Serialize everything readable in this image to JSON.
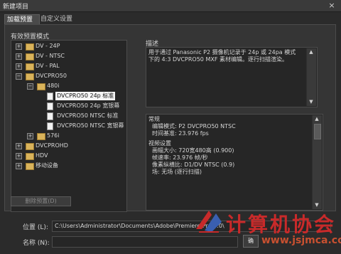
{
  "window": {
    "title": "新建项目",
    "close_glyph": "×"
  },
  "tabs": [
    {
      "label": "加载预置",
      "active": true
    },
    {
      "label": "自定义设置",
      "active": false
    }
  ],
  "presets_label": "有效预置模式",
  "tree": {
    "dv24p": "DV - 24P",
    "dvntsc": "DV - NTSC",
    "dvpal": "DV - PAL",
    "dvcpro50": "DVCPRO50",
    "f480i": "480i",
    "p1": "DVCPRO50 24p 标准",
    "p2": "DVCPRO50 24p 宽银幕",
    "p3": "DVCPRO50 NTSC 标准",
    "p4": "DVCPRO50 NTSC 宽银幕",
    "f576i": "576i",
    "dvcprohd": "DVCPROHD",
    "hdv": "HDV",
    "mobile": "移动设备"
  },
  "description": {
    "label": "描述",
    "text": "用于通过 Panasonic P2 摄像机记录于 24p 或 24pa 模式下的 4:3 DVCPRO50 MXF 素材编辑。逐行扫描渲染。"
  },
  "general": {
    "heading": "常规",
    "edit_mode": "编辑模式: P2 DVCPRO50 NTSC",
    "timebase": "时间基准: 23.976 fps",
    "video_heading": "视频设置",
    "frame_size": "画幅大小: 720宽480高 (0.900)",
    "frame_rate": "帧速率: 23.976 帧/秒",
    "pixel_aspect": "像素纵横比: D1/DV NTSC (0.9)",
    "fields": "场: 无场 (逐行扫描)"
  },
  "delete_button": "删除预置(D)",
  "location": {
    "label": "位置 (L):",
    "value": "C:\\Users\\Administrator\\Documents\\Adobe\\Premiere Pro\\3.0\\"
  },
  "name": {
    "label": "名称 (N):",
    "value": ""
  },
  "ok_button": "确",
  "watermark": {
    "text": "计算机协会",
    "url": "www.jsjmca.com"
  },
  "colors": {
    "selection": "#f4f4f4",
    "background": "#2b2b2b",
    "watermark": "#c82a2a"
  }
}
